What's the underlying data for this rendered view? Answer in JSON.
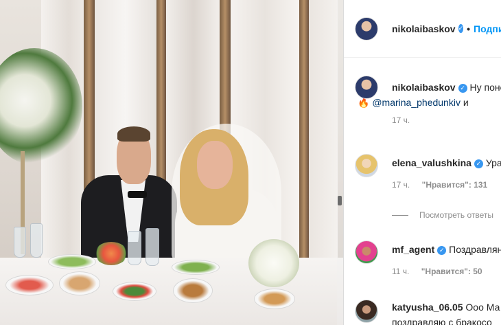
{
  "post": {
    "author": "nikolaibaskov",
    "dot": "•",
    "follow_label": "Подписаться"
  },
  "comments": [
    {
      "username": "nikolaibaskov",
      "text": "Ну поне",
      "line2_emoji": "🔥",
      "mention": "@marina_phedunkiv",
      "mention_tail": "и",
      "time": "17 ч."
    },
    {
      "username": "elena_valushkina",
      "text": "Ура",
      "time": "17 ч.",
      "likes": "\"Нравится\": 131"
    },
    {
      "username": "mf_agent",
      "text": "Поздравлян",
      "time": "11 ч.",
      "likes": "\"Нравится\": 50"
    },
    {
      "username": "katyusha_06.05",
      "text": "Ооо Ма",
      "line2": "поздравляю с бракосо"
    }
  ],
  "view_replies_label": "Посмотреть ответы",
  "colors": {
    "follow_blue": "#0095f6",
    "verified_blue": "#3897f0",
    "meta_gray": "#8e8e8e"
  }
}
